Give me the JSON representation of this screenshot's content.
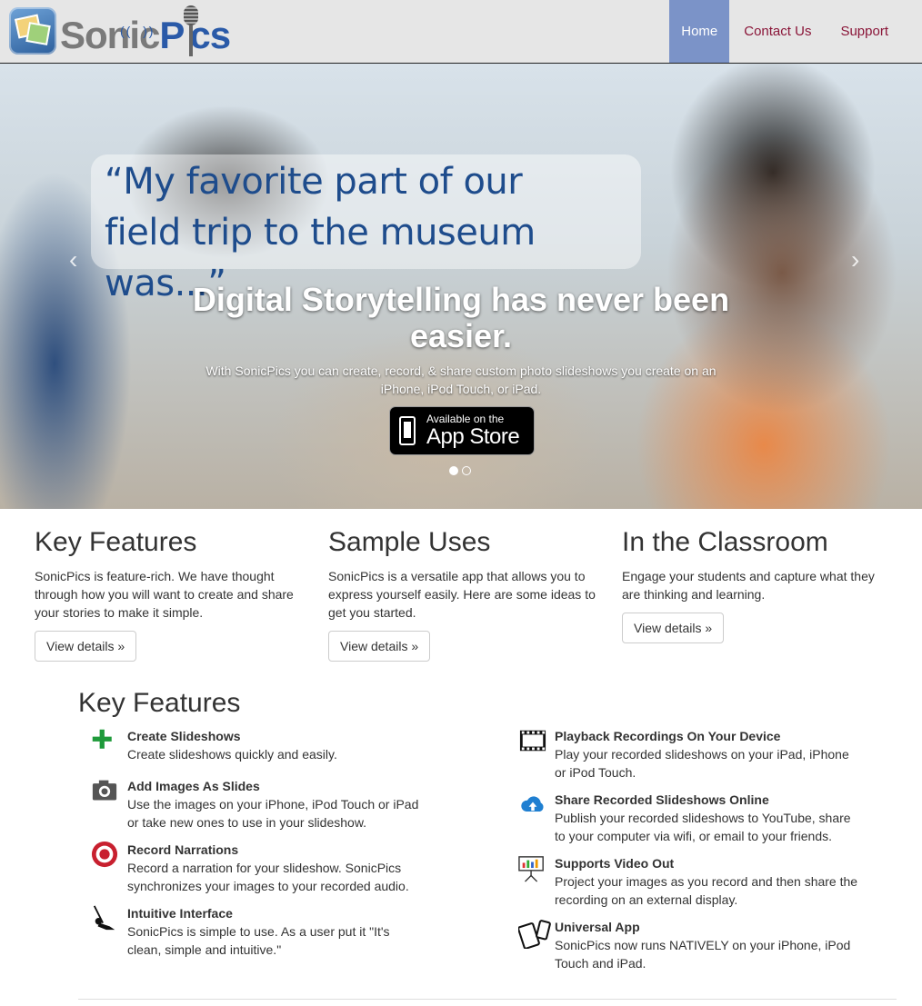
{
  "brand": {
    "name_part1": "Sonic",
    "name_part2": "P",
    "name_part3": "cs"
  },
  "nav": {
    "home": "Home",
    "contact": "Contact Us",
    "support": "Support"
  },
  "hero": {
    "quote_line1": "“My favorite part of our",
    "quote_line2": "field trip to the museum was...”",
    "title": "Digital Storytelling has never been easier.",
    "subtitle": "With SonicPics you can create, record, & share custom photo slideshows you create on an iPhone, iPod Touch, or iPad.",
    "appstore_small": "Available on the",
    "appstore_big": "App Store",
    "prev": "‹",
    "next": "›"
  },
  "columns": [
    {
      "title": "Key Features",
      "text": "SonicPics is feature-rich. We have thought through how you will want to create and share your stories to make it simple.",
      "button": "View details »"
    },
    {
      "title": "Sample Uses",
      "text": "SonicPics is a versatile app that allows you to express yourself easily. Here are some ideas to get you started.",
      "button": "View details »"
    },
    {
      "title": "In the Classroom",
      "text": "Engage your students and capture what they are thinking and learning.",
      "button": "View details »"
    }
  ],
  "features": {
    "heading": "Key Features",
    "left": [
      {
        "icon": "plus-icon",
        "title": "Create Slideshows",
        "text": "Create slideshows quickly and easily."
      },
      {
        "icon": "camera-icon",
        "title": "Add Images As Slides",
        "text": "Use the images on your iPhone, iPod Touch or iPad or take new ones to use in your slideshow."
      },
      {
        "icon": "record-icon",
        "title": "Record Narrations",
        "text": "Record a narration for your slideshow. SonicPics synchronizes your images to your recorded audio."
      },
      {
        "icon": "swing-icon",
        "title": "Intuitive Interface",
        "text": "SonicPics is simple to use. As a user put it \"It's clean, simple and intuitive.\""
      }
    ],
    "right": [
      {
        "icon": "film-icon",
        "title": "Playback Recordings On Your Device",
        "text": "Play your recorded slideshows on your iPad, iPhone or iPod Touch."
      },
      {
        "icon": "cloud-upload-icon",
        "title": "Share Recorded Slideshows Online",
        "text": "Publish your recorded slideshows to YouTube, share to your computer via wifi, or email to your friends."
      },
      {
        "icon": "projector-icon",
        "title": "Supports Video Out",
        "text": "Project your images as you record and then share the recording on an external display."
      },
      {
        "icon": "devices-icon",
        "title": "Universal App",
        "text": "SonicPics now runs NATIVELY on your iPhone, iPod Touch and iPad."
      }
    ]
  },
  "colors": {
    "nav_active_bg": "#7b93c8",
    "nav_link": "#8a1538",
    "brand_blue": "#2a5aa8",
    "plus_green": "#1e9a3a",
    "record_red": "#c8202f"
  }
}
